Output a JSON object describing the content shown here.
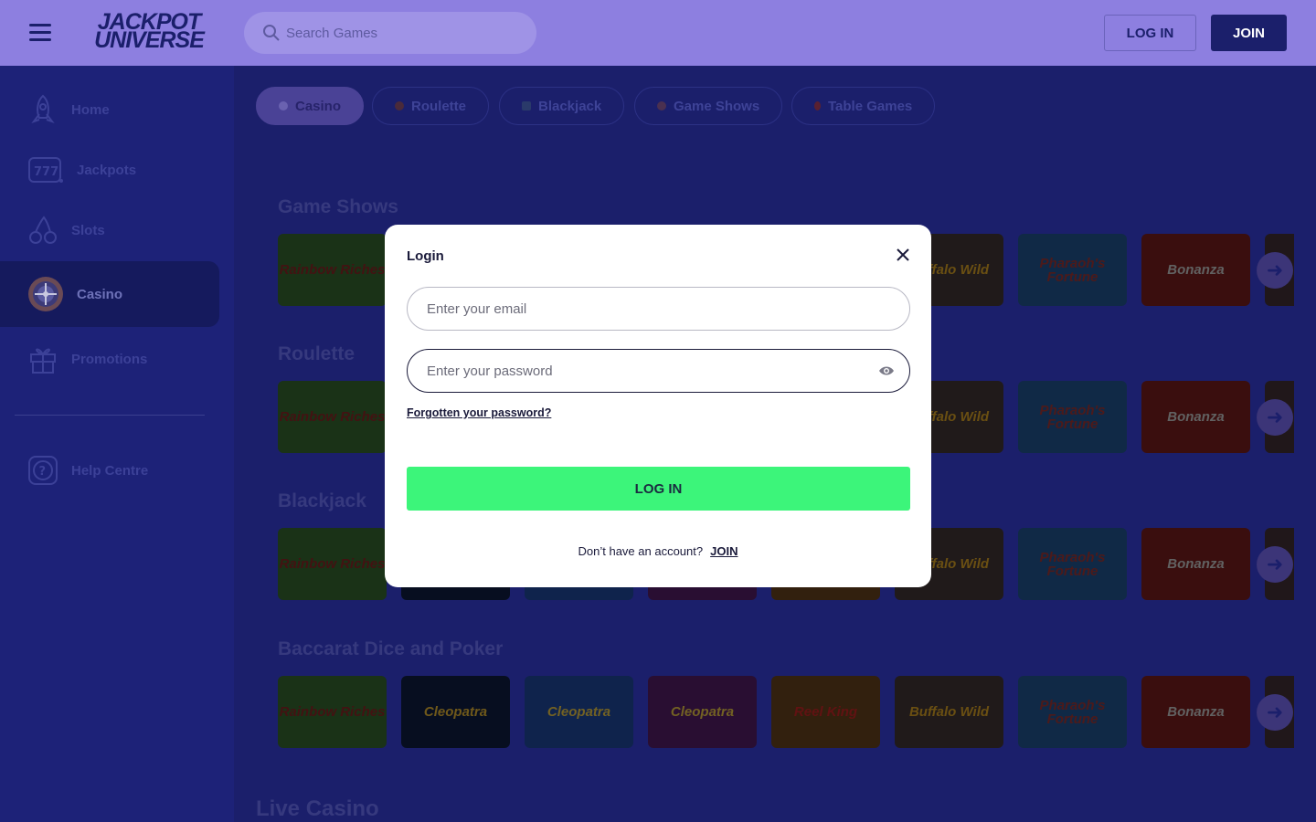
{
  "header": {
    "logo_line1": "JACKPOT",
    "logo_line2": "UNIVERSE",
    "search_placeholder": "Search Games",
    "login_label": "LOG IN",
    "join_label": "JOIN"
  },
  "sidebar": {
    "items": [
      {
        "label": "Home",
        "icon": "rocket-icon"
      },
      {
        "label": "Jackpots",
        "icon": "slot-777-icon"
      },
      {
        "label": "Slots",
        "icon": "cherries-icon"
      },
      {
        "label": "Casino",
        "icon": "roulette-wheel-icon",
        "active": true
      },
      {
        "label": "Promotions",
        "icon": "gift-icon"
      }
    ],
    "help": {
      "label": "Help Centre",
      "icon": "question-icon"
    }
  },
  "tabs": [
    {
      "label": "Casino",
      "active": true
    },
    {
      "label": "Roulette"
    },
    {
      "label": "Blackjack"
    },
    {
      "label": "Game Shows"
    },
    {
      "label": "Table Games"
    }
  ],
  "sections": [
    {
      "title": "Game Shows"
    },
    {
      "title": "Roulette"
    },
    {
      "title": "Blackjack"
    },
    {
      "title": "Baccarat Dice and Poker"
    }
  ],
  "tiles": [
    {
      "name": "Rainbow Riches",
      "bg": "#2f5a2a",
      "fg": "#7a2020"
    },
    {
      "name": "Cleopatra",
      "bg": "#0d1a3a",
      "fg": "#c9a030"
    },
    {
      "name": "Cleopatra",
      "bg": "#1b3f8a",
      "fg": "#d0b040"
    },
    {
      "name": "Cleopatra",
      "bg": "#4a1a5a",
      "fg": "#d0b040"
    },
    {
      "name": "Reel King",
      "bg": "#5a3a1a",
      "fg": "#b02020"
    },
    {
      "name": "Buffalo Wild",
      "bg": "#3a3030",
      "fg": "#c09020"
    },
    {
      "name": "Pharaoh's Fortune",
      "bg": "#1e4a80",
      "fg": "#8a3030"
    },
    {
      "name": "Bonanza",
      "bg": "#6a1a1a",
      "fg": "#b0b0b0"
    }
  ],
  "live_casino_title": "Live Casino",
  "modal": {
    "title": "Login",
    "email_placeholder": "Enter your email",
    "password_placeholder": "Enter your password",
    "forgot_label": "Forgotten your password?",
    "login_button": "LOG IN",
    "signup_prompt": "Don’t have an account?",
    "signup_link": "JOIN"
  },
  "colors": {
    "header_bg": "#8d7fe0",
    "page_bg": "#1b1f6b",
    "login_button_bg": "#3cf57a"
  }
}
